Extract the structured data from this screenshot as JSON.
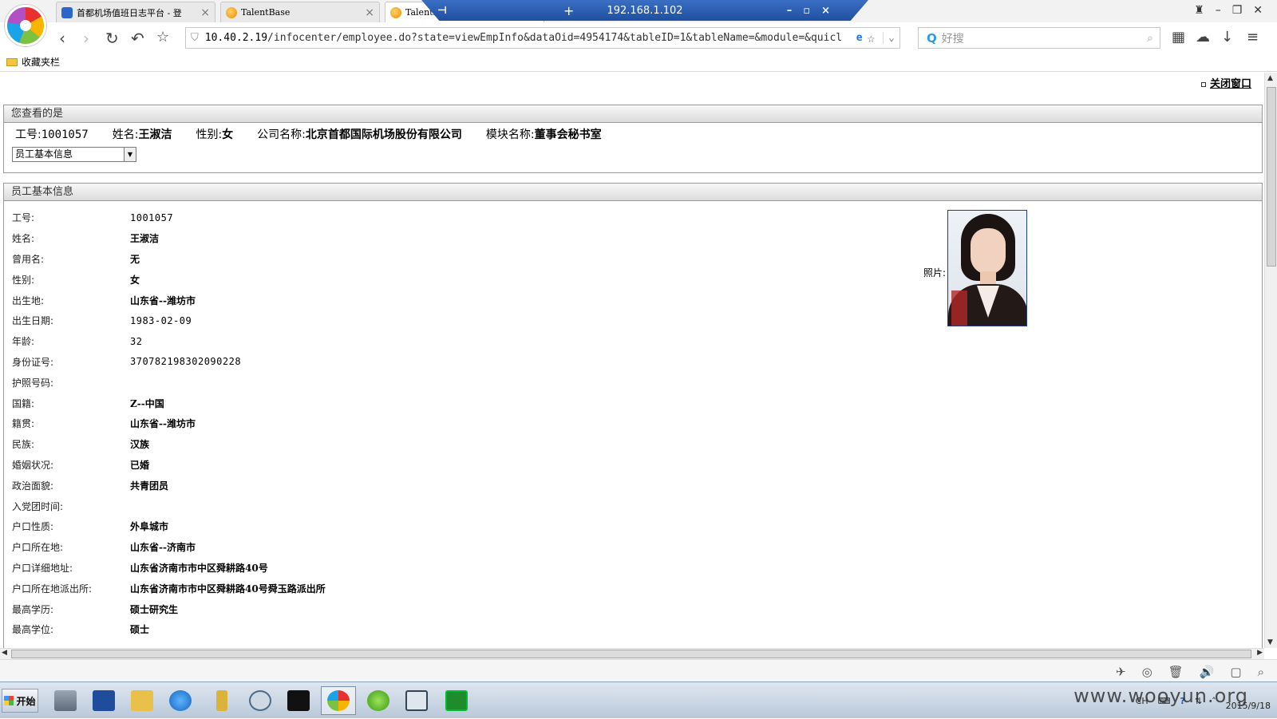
{
  "browser": {
    "tabs": [
      {
        "label": "首都机场值班日志平台 - 登",
        "icon": "monitor-icon"
      },
      {
        "label": "TalentBase",
        "icon": "talentbase-icon"
      },
      {
        "label": "TalentBase",
        "icon": "talentbase-icon"
      }
    ],
    "remote_session": {
      "host": "192.168.1.102"
    },
    "address": {
      "host": "10.40.2.19",
      "path": "/infocenter/employee.do?state=viewEmpInfo&dataOid=4954174&tableID=1&tableName=&module=&quicl"
    },
    "search_placeholder": "好搜",
    "favorites_label": "收藏夹栏"
  },
  "page": {
    "close_link": "关闭窗口",
    "viewing": {
      "title": "您查看的是",
      "emp_no_label": "工号:",
      "emp_no": "1001057",
      "name_label": "姓名:",
      "name": "王淑洁",
      "gender_label": "性别:",
      "gender": "女",
      "company_label": "公司名称:",
      "company": "北京首都国际机场股份有限公司",
      "module_label": "模块名称:",
      "module": "董事会秘书室",
      "select_value": "员工基本信息"
    },
    "basic": {
      "title": "员工基本信息",
      "photo_label": "照片:",
      "fields": [
        {
          "label": "工号:",
          "value": "1001057"
        },
        {
          "label": "姓名:",
          "value": "王淑洁"
        },
        {
          "label": "曾用名:",
          "value": "无"
        },
        {
          "label": "性别:",
          "value": "女"
        },
        {
          "label": "出生地:",
          "value": "山东省--潍坊市"
        },
        {
          "label": "出生日期:",
          "value": "1983-02-09"
        },
        {
          "label": "年龄:",
          "value": "32"
        },
        {
          "label": "身份证号:",
          "value": "370782198302090228"
        },
        {
          "label": "护照号码:",
          "value": ""
        },
        {
          "label": "国籍:",
          "value": "Z--中国"
        },
        {
          "label": "籍贯:",
          "value": "山东省--潍坊市"
        },
        {
          "label": "民族:",
          "value": "汉族"
        },
        {
          "label": "婚姻状况:",
          "value": "已婚"
        },
        {
          "label": "政治面貌:",
          "value": "共青团员"
        },
        {
          "label": "入党团时间:",
          "value": ""
        },
        {
          "label": "户口性质:",
          "value": "外阜城市"
        },
        {
          "label": "户口所在地:",
          "value": "山东省--济南市"
        },
        {
          "label": "户口详细地址:",
          "value": "山东省济南市市中区舜耕路40号"
        },
        {
          "label": "户口所在地派出所:",
          "value": "山东省济南市市中区舜耕路40号舜玉路派出所"
        },
        {
          "label": "最高学历:",
          "value": "硕士研究生"
        },
        {
          "label": "最高学位:",
          "value": "硕士"
        }
      ]
    }
  },
  "taskbar": {
    "start_label": "开始",
    "lang": "CH",
    "date": "2015/9/18"
  },
  "watermark": "www.wooyun.org"
}
